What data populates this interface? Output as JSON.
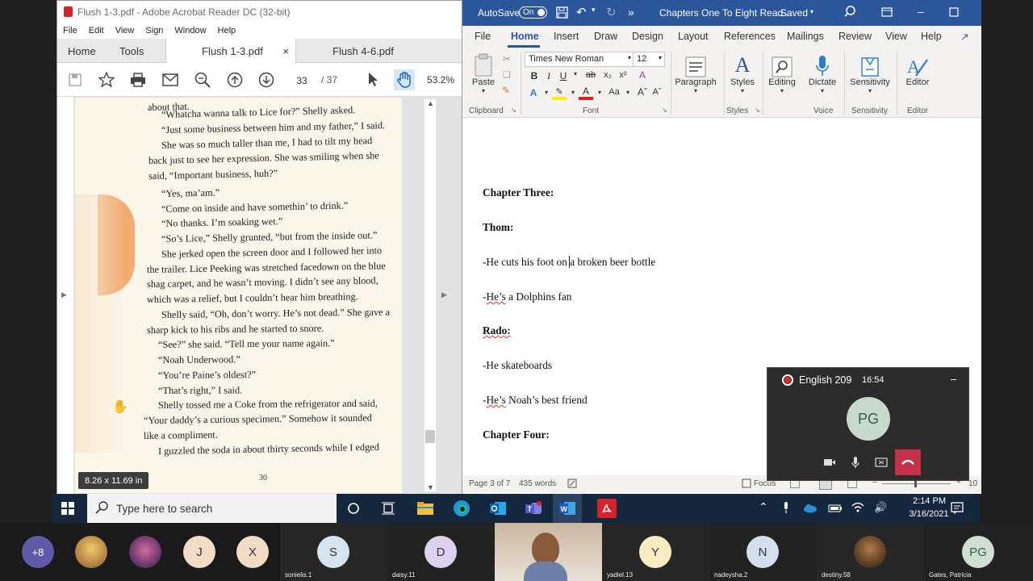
{
  "acrobat": {
    "title": "Flush 1-3.pdf - Adobe Acrobat Reader DC (32-bit)",
    "menu": [
      "File",
      "Edit",
      "View",
      "Sign",
      "Window",
      "Help"
    ],
    "nav": {
      "home": "Home",
      "tools": "Tools"
    },
    "tabs": [
      {
        "label": "Flush 1-3.pdf",
        "close": "×"
      },
      {
        "label": "Flush 4-6.pdf"
      }
    ],
    "page_current": "33",
    "page_total": "/ 37",
    "zoom": "53.2%",
    "page_size": "8.26 x 11.69 in",
    "page_number": "30",
    "text_lines": [
      "about that.",
      "“Whatcha wanna talk to Lice for?” Shelly asked.",
      "“Just some business between him and my father,” I said.",
      "She was so much taller than me, I had to tilt my head",
      "back just to see her expression. She was smiling when she",
      "said, “Important business, huh?”",
      "“Yes, ma’am.”",
      "“Come on inside and have somethin’ to drink.”",
      "“No thanks. I’m soaking wet.”",
      "“So’s Lice,” Shelly grunted, “but from the inside out.”",
      "She jerked open the screen door and I followed her into",
      "the trailer. Lice Peeking was stretched facedown on the blue",
      "shag carpet, and he wasn’t moving. I didn’t see any blood,",
      "which was a relief, but I couldn’t hear him breathing.",
      "Shelly said, “Oh, don’t worry. He’s not dead.” She gave a",
      "sharp kick to his ribs and he started to snore.",
      "“See?” she said. “Tell me your name again.”",
      "“Noah Underwood.”",
      "“You’re Paine’s oldest?”",
      "“That’s right,” I said.",
      "Shelly tossed me a Coke from the refrigerator and said,",
      "“Your daddy’s a curious specimen.” Somehow it sounded",
      "like a compliment.",
      "I guzzled the soda in about thirty seconds while I edged"
    ]
  },
  "word": {
    "autosave": "AutoSave",
    "autosave_state": "On",
    "title": "Chapters One To Eight Read...",
    "saved": "Saved",
    "more": "»",
    "tabs": [
      "File",
      "Home",
      "Insert",
      "Draw",
      "Design",
      "Layout",
      "References",
      "Mailings",
      "Review",
      "View",
      "Help"
    ],
    "font_name": "Times New Roman",
    "font_size": "12",
    "groups": {
      "clipboard": "Clipboard",
      "font": "Font",
      "styles": "Styles",
      "voice": "Voice",
      "sensitivity": "Sensitivity",
      "editor": "Editor"
    },
    "buttons": {
      "paste": "Paste",
      "paragraph": "Paragraph",
      "styles": "Styles",
      "editing": "Editing",
      "dictate": "Dictate",
      "sensitivity": "Sensitivity",
      "editor": "Editor"
    },
    "doc": {
      "h1": "Chapter Three:",
      "h2": "Thom:",
      "l1a": "-He cuts his foot on ",
      "l1b": "a broken beer bottle",
      "l2a": "-",
      "l2b": "He’s",
      "l2c": " a Dolphins fan",
      "h3": "Rado:",
      "l3": "-He skateboards",
      "l4a": "-",
      "l4b": "He’s",
      "l4c": " Noah’s best friend",
      "h4": "Chapter Four:"
    },
    "status": {
      "page": "Page 3 of 7",
      "words": "435 words",
      "focus": "Focus",
      "zoom": "10"
    }
  },
  "teams": {
    "meeting": "English 209",
    "timer": "16:54",
    "initials": "PG",
    "minimize": "–"
  },
  "taskbar": {
    "search_placeholder": "Type here to search",
    "time": "2:14 PM",
    "date": "3/16/2021"
  },
  "gallery": {
    "more_count": "+8",
    "participants": [
      {
        "initial": "J"
      },
      {
        "initial": "X"
      },
      {
        "initial": "S",
        "name": "sonielis.1"
      },
      {
        "initial": "D",
        "name": "daisy.11"
      },
      {
        "initial": "Y",
        "name": "yadiel.13"
      },
      {
        "initial": "N",
        "name": "nadeysha.2"
      },
      {
        "name": "destiny.58"
      },
      {
        "initial": "PG",
        "name": "Gates, Patricia"
      }
    ]
  },
  "colors": {
    "word_blue": "#2b579a",
    "acrobat_red": "#d4232c",
    "taskbar": "#14273d",
    "record_red": "#e22929"
  }
}
